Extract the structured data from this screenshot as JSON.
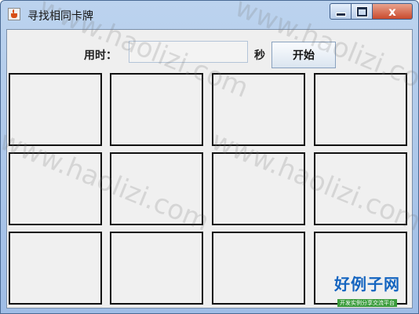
{
  "window": {
    "title": "寻找相同卡牌",
    "controls": {
      "close_label": "x"
    }
  },
  "toolbar": {
    "time_label": "用时：",
    "time_value": "",
    "seconds_label": "秒",
    "start_label": "开始"
  },
  "cards": [
    {
      "id": 1
    },
    {
      "id": 2
    },
    {
      "id": 3
    },
    {
      "id": 4
    },
    {
      "id": 5
    },
    {
      "id": 6
    },
    {
      "id": 7
    },
    {
      "id": 8
    },
    {
      "id": 9
    },
    {
      "id": 10
    },
    {
      "id": 11
    },
    {
      "id": 12
    }
  ],
  "watermark": {
    "text": "www.haolizi.com"
  },
  "logo": {
    "main": "好例子网",
    "sub": "开发实例分享交流平台"
  },
  "colors": {
    "titlebar": "#bcd3ee",
    "close_button": "#c94a2d",
    "card_border": "#111111",
    "client_bg": "#efefef",
    "logo_text": "#1565c0",
    "logo_sub_bg": "#3a9c3c"
  },
  "icons": {
    "app": "java-cup-icon",
    "minimize": "minimize-icon",
    "maximize": "maximize-icon",
    "close": "close-icon"
  }
}
